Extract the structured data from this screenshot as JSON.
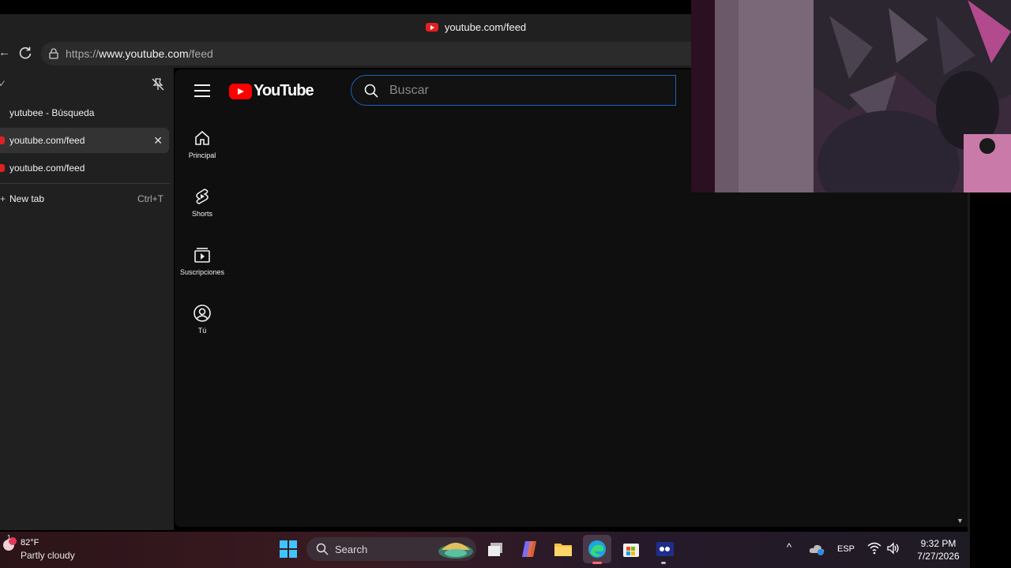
{
  "browser": {
    "title": "youtube.com/feed",
    "url_prefix": "https://",
    "url_host": "www.youtube.com",
    "url_path": "/feed",
    "tabs": [
      {
        "label": "yutubee - Búsqueda",
        "active": false
      },
      {
        "label": "youtube.com/feed",
        "active": true,
        "close": "✕"
      },
      {
        "label": "youtube.com/feed",
        "active": false
      }
    ],
    "new_tab_label": "New tab",
    "new_tab_shortcut": "Ctrl+T"
  },
  "youtube": {
    "logo_text": "YouTube",
    "search_placeholder": "Buscar",
    "nav": [
      {
        "label": "Principal",
        "icon": "home-icon"
      },
      {
        "label": "Shorts",
        "icon": "shorts-icon"
      },
      {
        "label": "Suscripciones",
        "icon": "subscriptions-icon"
      },
      {
        "label": "Tú",
        "icon": "you-icon"
      }
    ]
  },
  "taskbar": {
    "temperature": "82°F",
    "condition": "Partly cloudy",
    "weather_badge": "1",
    "search_label": "Search",
    "language": "ESP",
    "time": "9:32 PM",
    "date": "7/27/2026"
  },
  "colors": {
    "youtube_red": "#ff0000",
    "search_focus_border": "#1c62b9",
    "page_background": "#0f0f0f"
  }
}
